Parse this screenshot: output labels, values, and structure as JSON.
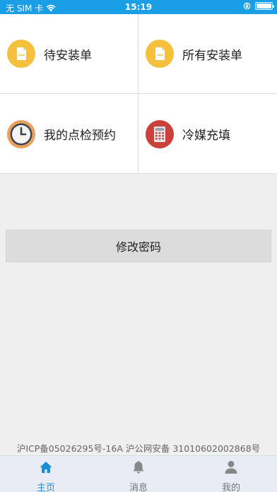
{
  "status_bar": {
    "carrier": "无 SIM 卡",
    "time": "15:19"
  },
  "menu": [
    {
      "label": "待安装单",
      "icon": "document-icon",
      "color": "#f5c03c"
    },
    {
      "label": "所有安装单",
      "icon": "document-icon",
      "color": "#f5c03c"
    },
    {
      "label": "我的点检预约",
      "icon": "clock-icon",
      "color": "#e8a05c"
    },
    {
      "label": "冷媒充填",
      "icon": "calculator-icon",
      "color": "#c9413a"
    }
  ],
  "change_password_label": "修改密码",
  "icp_text": "沪ICP备05026295号-16A  沪公网安备 31010602002868号",
  "tabbar": {
    "tabs": [
      {
        "label": "主页",
        "icon": "home-icon",
        "active": true
      },
      {
        "label": "消息",
        "icon": "bell-icon",
        "active": false
      },
      {
        "label": "我的",
        "icon": "user-icon",
        "active": false
      }
    ]
  },
  "colors": {
    "accent": "#1a9ee6",
    "background": "#efefef"
  }
}
